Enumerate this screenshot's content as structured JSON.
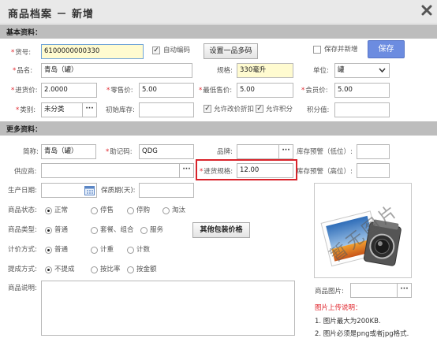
{
  "title": "商品档案 － 新增",
  "sections": {
    "basic": "基本资料：",
    "more": "更多资料："
  },
  "basic": {
    "code_label": "货号:",
    "code_value": "6100000000330",
    "auto_code_label": "自动编码",
    "set_barcode_btn": "设置一品多码",
    "save_new_label": "保存并新增",
    "save_btn": "保存",
    "name_label": "品名:",
    "name_value": "青岛（罐）",
    "spec_label": "规格:",
    "spec_value": "330毫升",
    "unit_label": "单位:",
    "unit_value": "罐",
    "purchase_price_label": "进货价:",
    "purchase_price_value": "2.0000",
    "retail_price_label": "零售价:",
    "retail_price_value": "5.00",
    "min_price_label": "最低售价:",
    "min_price_value": "5.00",
    "member_price_label": "会员价:",
    "member_price_value": "5.00",
    "category_label": "类别:",
    "category_value": "未分类",
    "init_stock_label": "初始库存:",
    "init_stock_value": "",
    "allow_discount_label": "允许改价折扣",
    "allow_points_label": "允许积分",
    "points_label": "积分值:",
    "points_value": ""
  },
  "more": {
    "short_name_label": "简称:",
    "short_name_value": "青岛（罐）",
    "mnemonic_label": "助记码:",
    "mnemonic_value": "QDG",
    "brand_label": "品牌:",
    "brand_value": "",
    "stock_low_label": "库存预警（低位）:",
    "stock_low_value": "",
    "supplier_label": "供应商:",
    "supplier_value": "",
    "purchase_spec_label": "进货规格:",
    "purchase_spec_value": "12.00",
    "stock_high_label": "库存预警（高位）:",
    "stock_high_value": "",
    "prod_date_label": "生产日期:",
    "prod_date_value": "",
    "shelf_life_label": "保质期(天):",
    "shelf_life_value": "",
    "status_label": "商品状态:",
    "status_options": [
      "正常",
      "停售",
      "停购",
      "淘汰"
    ],
    "type_label": "商品类型:",
    "type_options": [
      "普通",
      "套餐、组合",
      "服务"
    ],
    "other_pack_btn": "其他包装价格",
    "pricing_label": "计价方式:",
    "pricing_options": [
      "普通",
      "计重",
      "计数"
    ],
    "commission_label": "提成方式:",
    "commission_options": [
      "不提成",
      "按比率",
      "按金额"
    ],
    "desc_label": "商品说明:",
    "image_label": "商品图片:",
    "image_placeholder": "暂无图片",
    "upload_note_title": "图片上传说明：",
    "upload_note_1": "1. 图片最大为200KB.",
    "upload_note_2": "2. 图片必须是png或者jpg格式."
  }
}
